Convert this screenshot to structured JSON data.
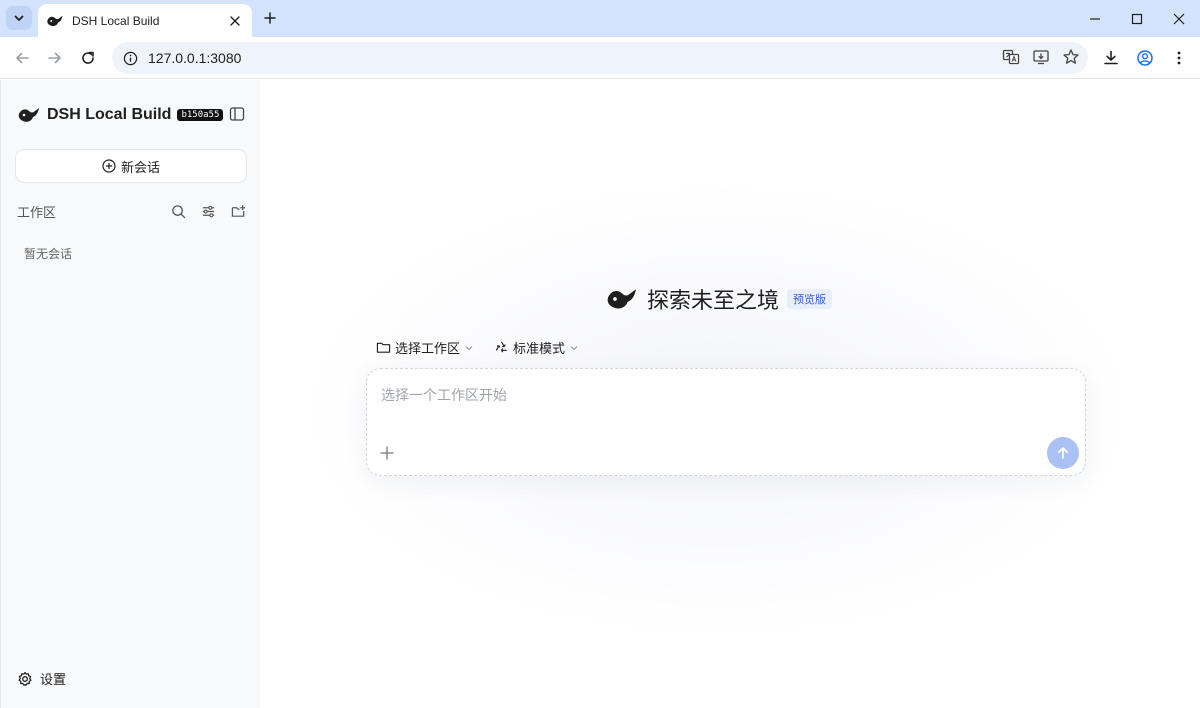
{
  "browser": {
    "tab_title": "DSH Local Build",
    "url": "127.0.0.1:3080"
  },
  "sidebar": {
    "brand_name": "DSH Local Build",
    "build_badge": "b150a55",
    "new_chat_label": "新会话",
    "workspace_label": "工作区",
    "empty_text": "暂无会话",
    "settings_label": "设置"
  },
  "main": {
    "hero_title": "探索未至之境",
    "hero_badge": "预览版",
    "workspace_select_label": "选择工作区",
    "mode_label": "标准模式",
    "composer_placeholder": "选择一个工作区开始"
  },
  "colors": {
    "tabbar": "#d3e3fd",
    "send_button": "#aac1f5",
    "badge_text": "#3b5bdb"
  }
}
